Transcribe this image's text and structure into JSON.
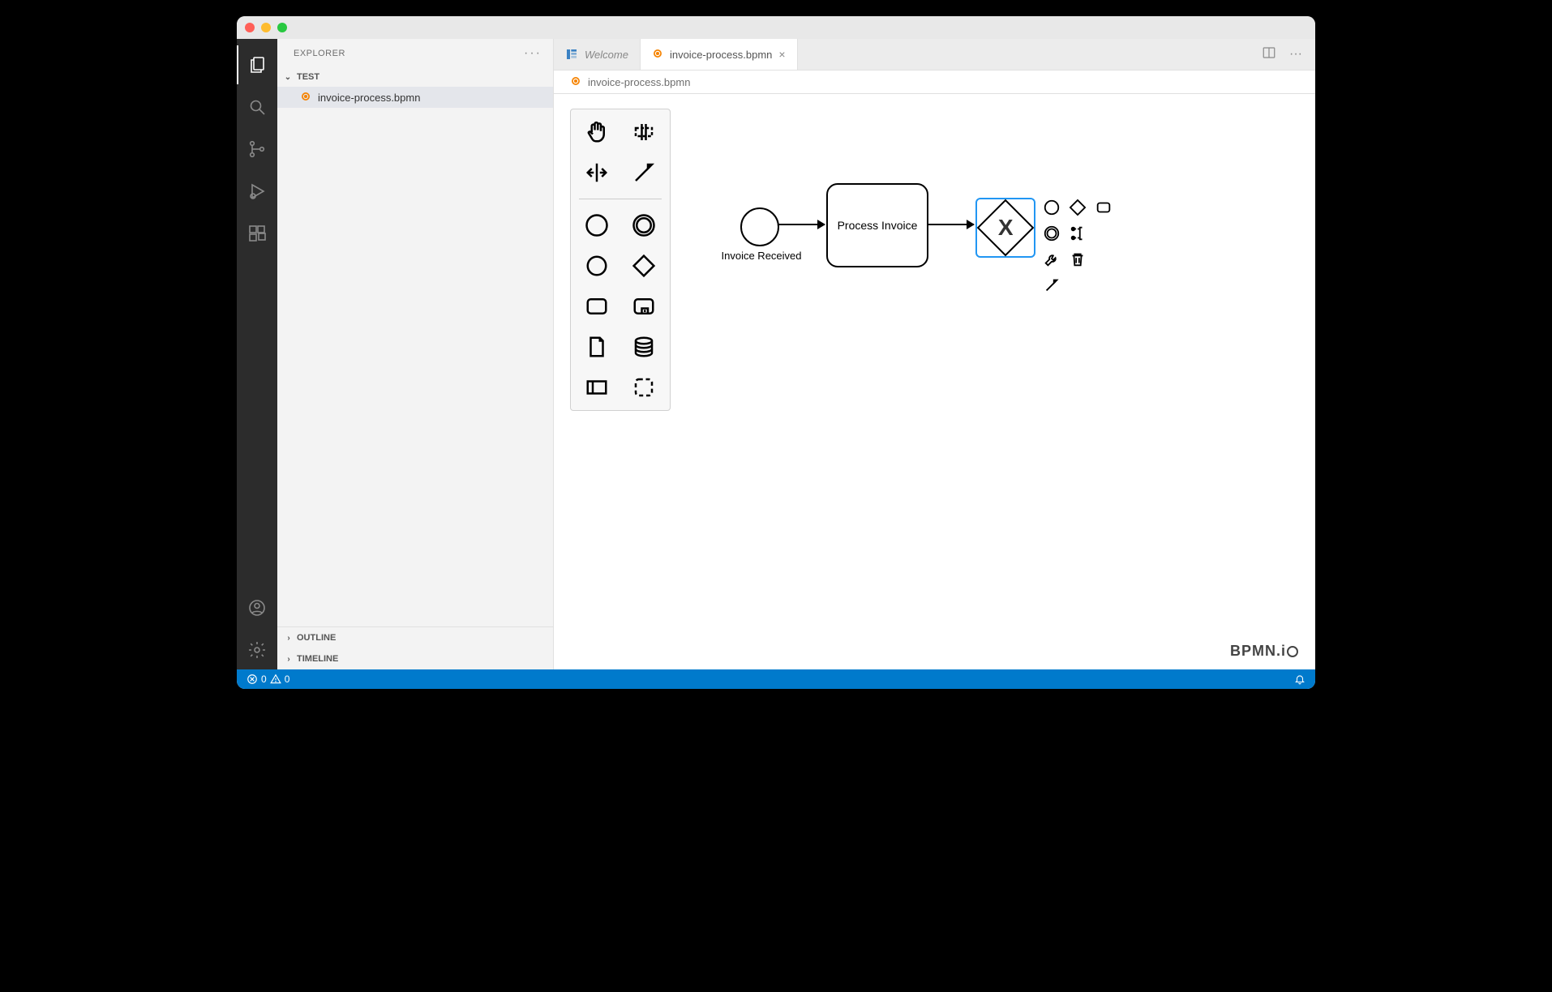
{
  "sidebar": {
    "title": "EXPLORER",
    "folder": "TEST",
    "files": [
      {
        "name": "invoice-process.bpmn"
      }
    ],
    "outline": "OUTLINE",
    "timeline": "TIMELINE"
  },
  "tabs": {
    "welcome": "Welcome",
    "active": "invoice-process.bpmn"
  },
  "breadcrumb": {
    "file": "invoice-process.bpmn"
  },
  "diagram": {
    "start_label": "Invoice Received",
    "task_label": "Process Invoice",
    "gateway_marker": "X"
  },
  "watermark": "BPMN.i",
  "status": {
    "errors": "0",
    "warnings": "0"
  }
}
